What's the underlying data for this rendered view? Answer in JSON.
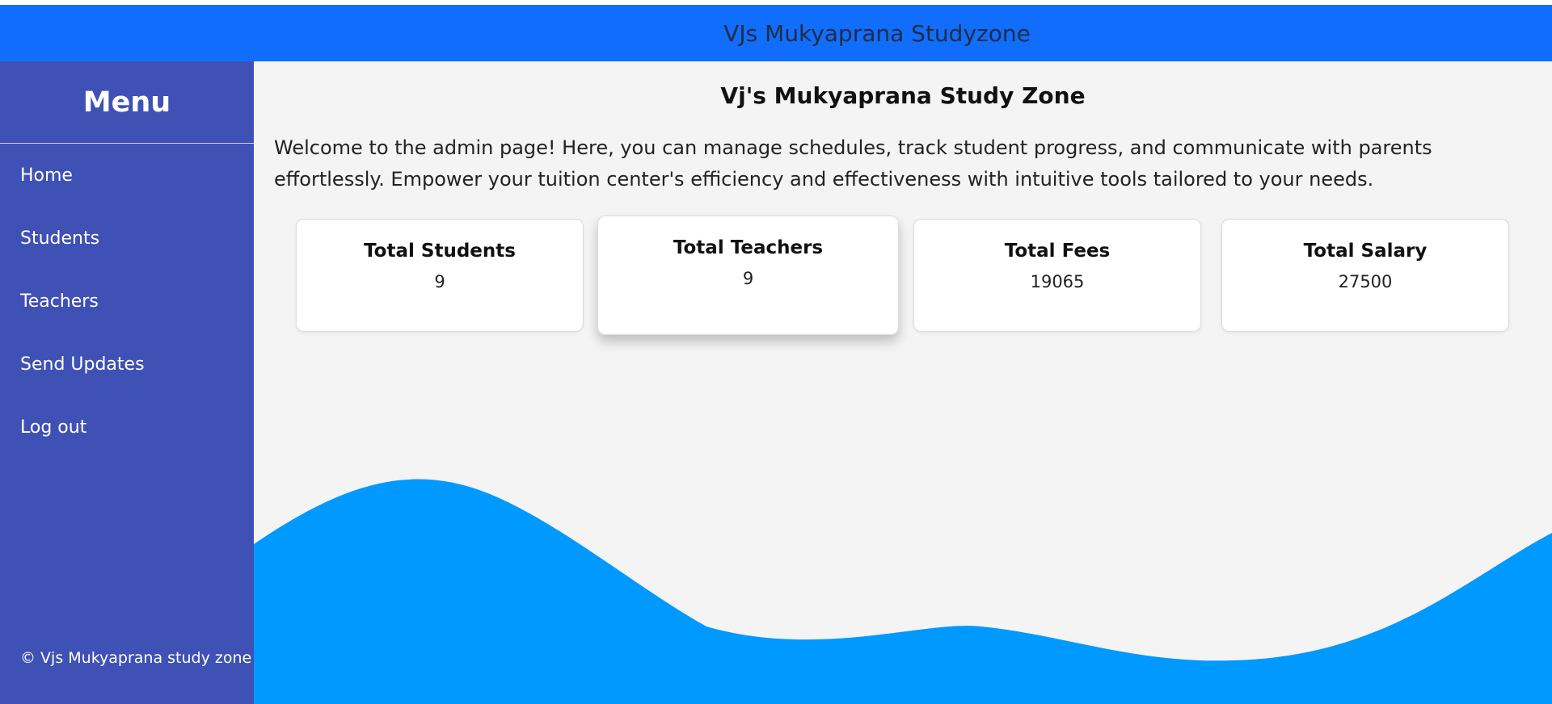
{
  "header": {
    "title": "VJs Mukyaprana Studyzone"
  },
  "sidebar": {
    "title": "Menu",
    "items": [
      {
        "label": "Home"
      },
      {
        "label": "Students"
      },
      {
        "label": "Teachers"
      },
      {
        "label": "Send Updates"
      },
      {
        "label": "Log out"
      }
    ],
    "footer": "© Vjs Mukyaprana study zone"
  },
  "main": {
    "title": "Vj's Mukyaprana Study Zone",
    "welcome": "Welcome to the admin page! Here, you can manage schedules, track student progress, and communicate with parents effortlessly. Empower your tuition center's efficiency and effectiveness with intuitive tools tailored to your needs.",
    "cards": [
      {
        "label": "Total Students",
        "value": "9"
      },
      {
        "label": "Total Teachers",
        "value": "9"
      },
      {
        "label": "Total Fees",
        "value": "19065"
      },
      {
        "label": "Total Salary",
        "value": "27500"
      }
    ]
  },
  "colors": {
    "header_bg": "#116dfc",
    "sidebar_bg": "#3f51b5",
    "main_bg": "#f4f4f4",
    "wave": "#0099ff"
  }
}
